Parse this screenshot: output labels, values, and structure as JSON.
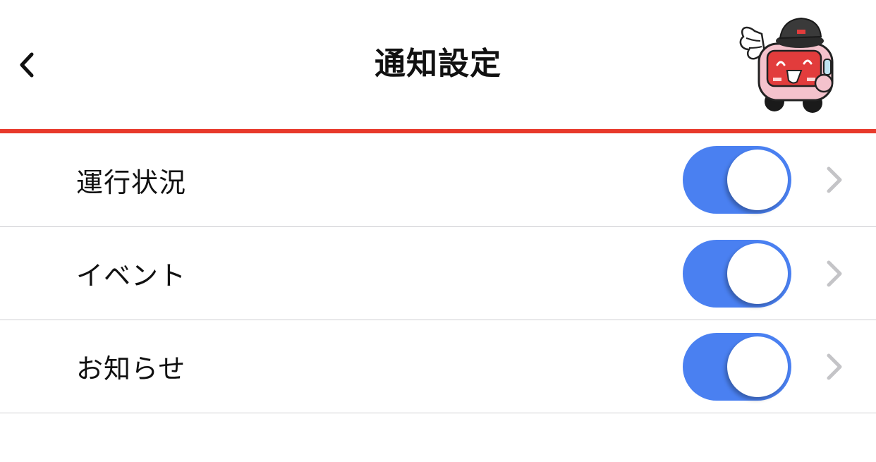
{
  "header": {
    "title": "通知設定",
    "back_icon": "chevron-left-icon",
    "mascot": "train-mascot-character"
  },
  "settings": [
    {
      "label": "運行状況",
      "enabled": true
    },
    {
      "label": "イベント",
      "enabled": true
    },
    {
      "label": "お知らせ",
      "enabled": true
    }
  ],
  "colors": {
    "accent_rule": "#e8392b",
    "toggle_on": "#4a80f1",
    "chevron": "#c4c4c7",
    "divider": "#cfcfd2"
  }
}
